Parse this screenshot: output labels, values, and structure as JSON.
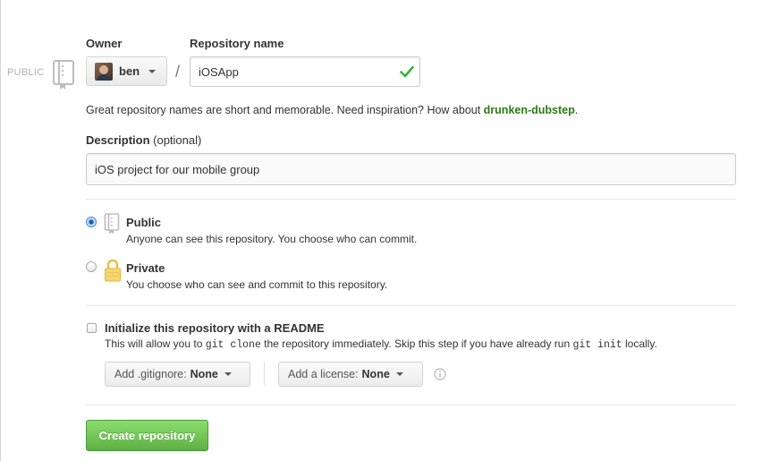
{
  "visibility_tag": "PUBLIC",
  "owner": {
    "label": "Owner",
    "name": "ben"
  },
  "repository": {
    "label": "Repository name",
    "value": "iOSApp",
    "separator": "/"
  },
  "hint": {
    "text": "Great repository names are short and memorable. Need inspiration? How about ",
    "suggestion": "drunken-dubstep",
    "suffix": "."
  },
  "description": {
    "label": "Description",
    "optional": "(optional)",
    "value": "iOS project for our mobile group"
  },
  "visibility": {
    "selected": "public",
    "public": {
      "title": "Public",
      "desc": "Anyone can see this repository. You choose who can commit."
    },
    "private": {
      "title": "Private",
      "desc": "You choose who can see and commit to this repository."
    }
  },
  "readme": {
    "checked": false,
    "title": "Initialize this repository with a README",
    "desc_1": "This will allow you to ",
    "code_1": "git clone",
    "desc_2": " the repository immediately. Skip this step if you have already run ",
    "code_2": "git init",
    "desc_3": " locally."
  },
  "gitignore": {
    "label": "Add .gitignore:",
    "value": "None"
  },
  "license": {
    "label": "Add a license:",
    "value": "None"
  },
  "submit_label": "Create repository",
  "colors": {
    "accent_green": "#60b044",
    "suggestion_green": "#2c7a14",
    "radio_blue": "#1f5fb8"
  }
}
